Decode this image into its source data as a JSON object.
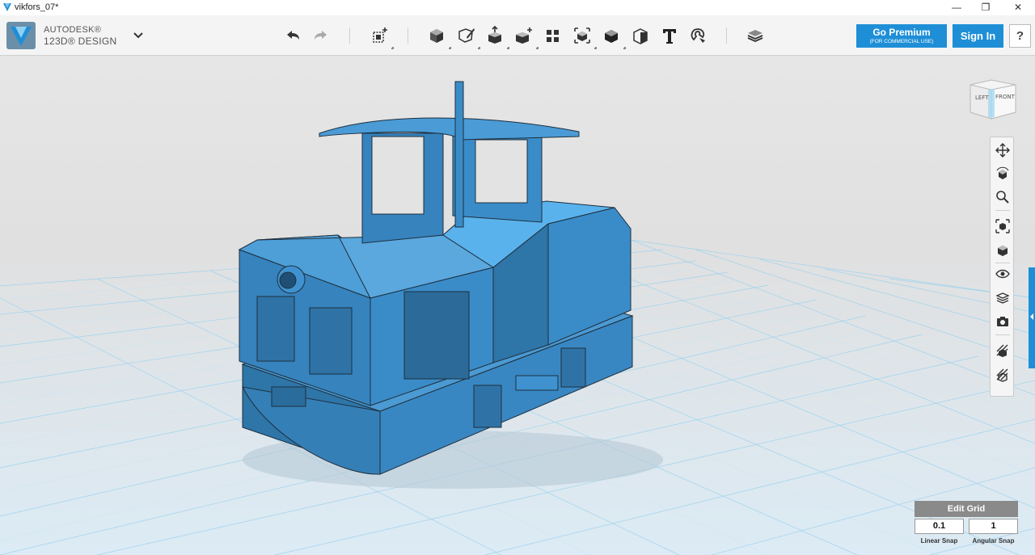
{
  "window": {
    "title": "vikfors_07*",
    "minimize": "—",
    "maximize": "❐",
    "close": "✕"
  },
  "brand": {
    "line1": "AUTODESK®",
    "line2": "123D® DESIGN"
  },
  "toolbar": {
    "icons": [
      "undo-icon",
      "redo-icon",
      "transform-icon",
      "primitives-icon",
      "sketch-icon",
      "construct-icon",
      "modify-icon",
      "pattern-icon",
      "grouping-icon",
      "combine-icon",
      "measure-icon",
      "text-icon",
      "snap-icon",
      "materials-icon"
    ]
  },
  "account": {
    "premium_label": "Go Premium",
    "premium_sub": "(FOR COMMERCIAL USE)",
    "signin_label": "Sign In",
    "help_label": "?"
  },
  "viewcube": {
    "left_face": "LEFT",
    "front_face": "FRONT"
  },
  "navbar": {
    "icons": [
      "pan-icon",
      "orbit-icon",
      "zoom-icon",
      "fit-icon",
      "view-icon",
      "visibility-icon",
      "materials-view-icon",
      "snapshot-icon",
      "grid-icon",
      "outline-icon"
    ]
  },
  "grid": {
    "edit_label": "Edit Grid",
    "linear_snap_value": "0.1",
    "angular_snap_value": "1",
    "linear_snap_label": "Linear Snap",
    "angular_snap_label": "Angular Snap"
  },
  "colors": {
    "accent": "#1e8fd6",
    "model": "#3a8cc8"
  }
}
